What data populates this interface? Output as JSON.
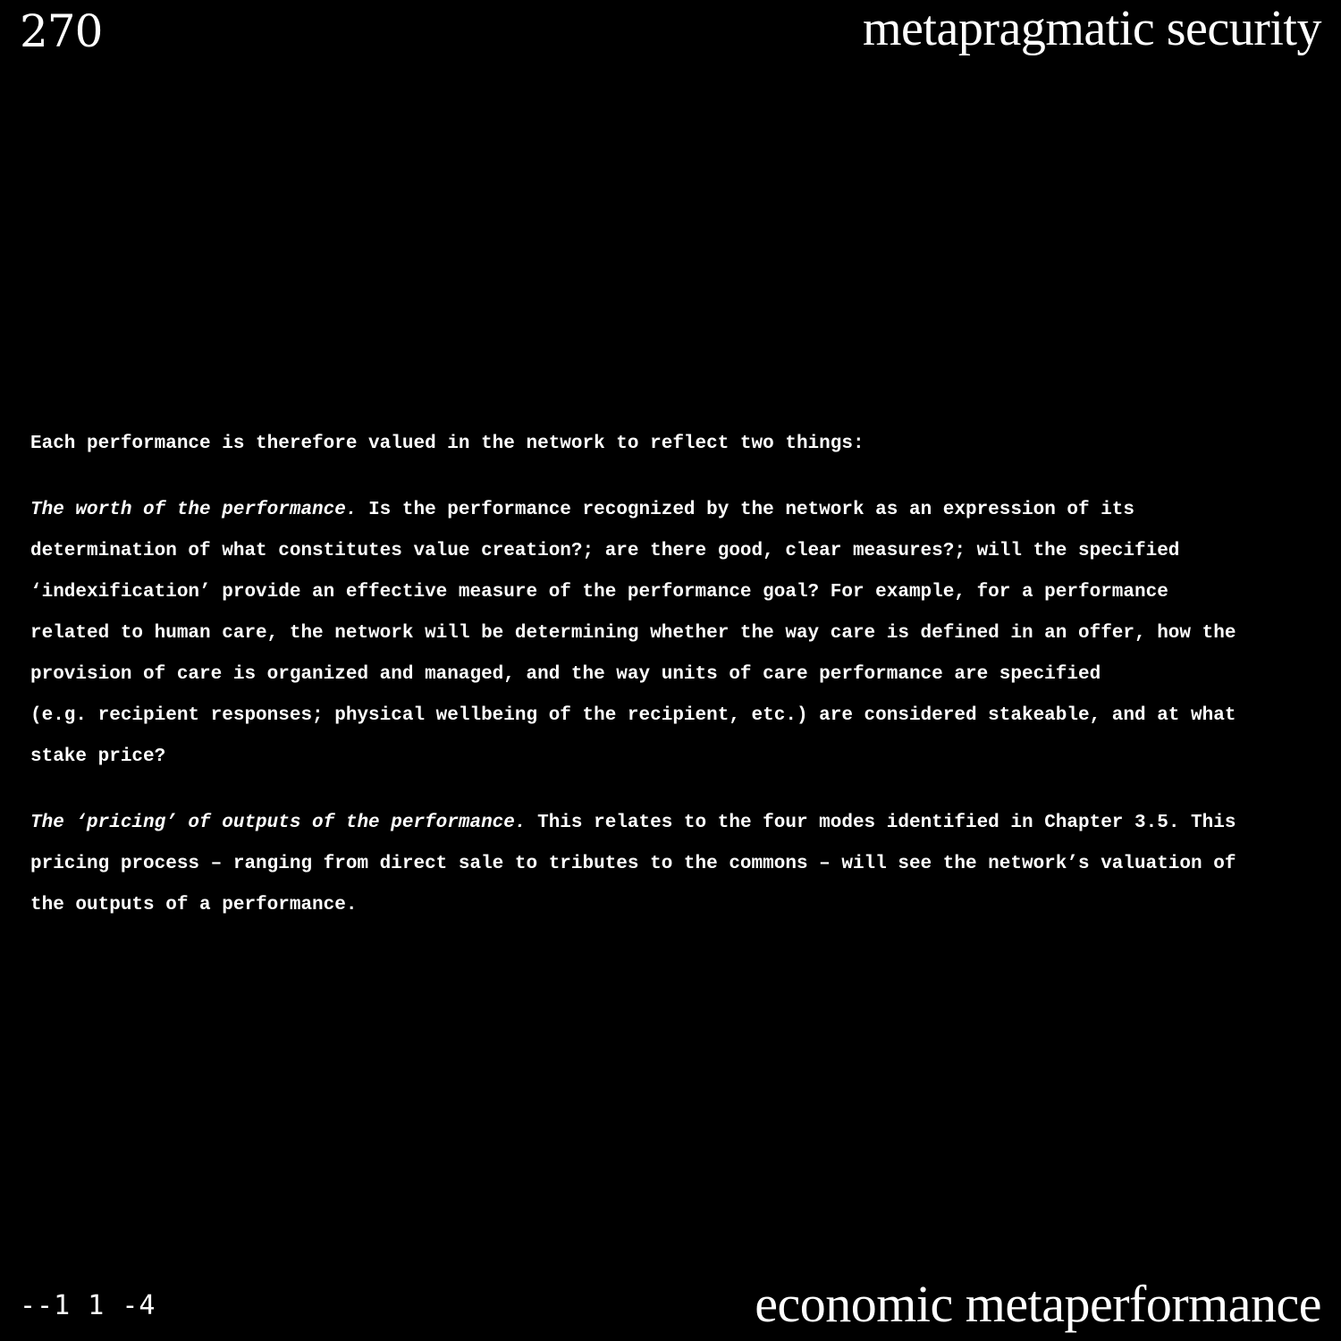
{
  "header": {
    "page_number": "270",
    "title": "metapragmatic security"
  },
  "body": {
    "intro": "Each performance is therefore valued in the network to reflect two things:",
    "item1_lead": "The worth of the performance.",
    "item1_text": " Is the performance recognized by the network as an expression of its\ndetermination of what constitutes value creation?; are there good, clear measures?; will the specified\n‘indexification’ provide an effective measure of the performance goal? For example, for a performance\nrelated to human care, the network will be determining whether the way care is defined in an offer, how the\nprovision of care is organized and managed, and the way units of care performance are specified\n(e.g. recipient responses; physical wellbeing of the recipient, etc.) are considered stakeable, and at what\nstake price?",
    "item2_lead": "The ‘pricing’ of outputs of the performance.",
    "item2_text": " This relates to the four modes identified in Chapter 3.5. This\npricing process – ranging from direct sale to tributes to the commons – will see the network’s valuation of\nthe outputs of a performance."
  },
  "footer": {
    "code": "--1 1 -4",
    "title": "economic metaperformance"
  }
}
